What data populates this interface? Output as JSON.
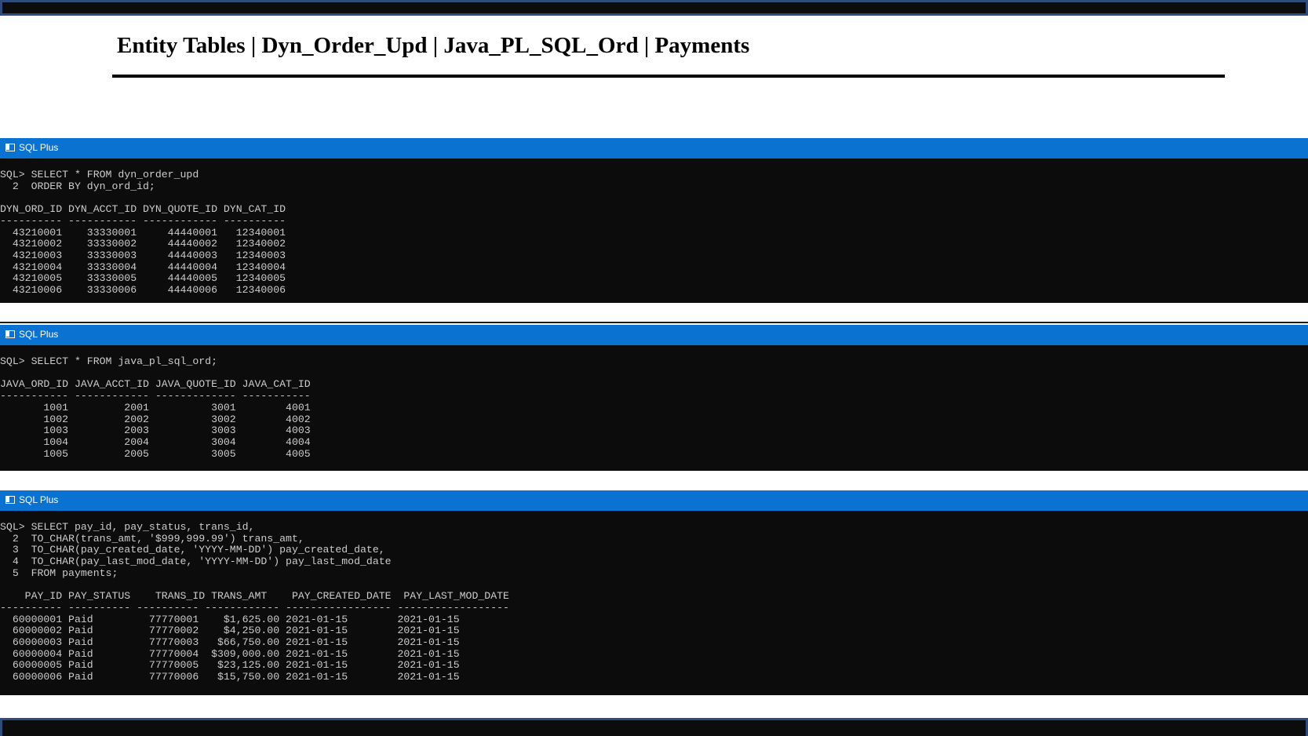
{
  "page": {
    "title": "Entity Tables | Dyn_Order_Upd | Java_PL_SQL_Ord | Payments"
  },
  "windows": [
    {
      "title": "SQL Plus",
      "query_lines": [
        "SQL> SELECT * FROM dyn_order_upd",
        "  2  ORDER BY dyn_ord_id;"
      ],
      "header": "DYN_ORD_ID DYN_ACCT_ID DYN_QUOTE_ID DYN_CAT_ID",
      "underline": "---------- ----------- ------------ ----------",
      "rows": [
        "  43210001    33330001     44440001   12340001",
        "  43210002    33330002     44440002   12340002",
        "  43210003    33330003     44440003   12340003",
        "  43210004    33330004     44440004   12340004",
        "  43210005    33330005     44440005   12340005",
        "  43210006    33330006     44440006   12340006"
      ]
    },
    {
      "title": "SQL Plus",
      "query_lines": [
        "SQL> SELECT * FROM java_pl_sql_ord;"
      ],
      "header": "JAVA_ORD_ID JAVA_ACCT_ID JAVA_QUOTE_ID JAVA_CAT_ID",
      "underline": "----------- ------------ ------------- -----------",
      "rows": [
        "       1001         2001          3001        4001",
        "       1002         2002          3002        4002",
        "       1003         2003          3003        4003",
        "       1004         2004          3004        4004",
        "       1005         2005          3005        4005"
      ]
    },
    {
      "title": "SQL Plus",
      "query_lines": [
        "SQL> SELECT pay_id, pay_status, trans_id,",
        "  2  TO_CHAR(trans_amt, '$999,999.99') trans_amt,",
        "  3  TO_CHAR(pay_created_date, 'YYYY-MM-DD') pay_created_date,",
        "  4  TO_CHAR(pay_last_mod_date, 'YYYY-MM-DD') pay_last_mod_date",
        "  5  FROM payments;"
      ],
      "header": "    PAY_ID PAY_STATUS    TRANS_ID TRANS_AMT    PAY_CREATED_DATE  PAY_LAST_MOD_DATE",
      "underline": "---------- ---------- ---------- ------------ ----------------- ------------------",
      "rows": [
        "  60000001 Paid         77770001    $1,625.00 2021-01-15        2021-01-15",
        "  60000002 Paid         77770002    $4,250.00 2021-01-15        2021-01-15",
        "  60000003 Paid         77770003   $66,750.00 2021-01-15        2021-01-15",
        "  60000004 Paid         77770004  $309,000.00 2021-01-15        2021-01-15",
        "  60000005 Paid         77770005   $23,125.00 2021-01-15        2021-01-15",
        "  60000006 Paid         77770006   $15,750.00 2021-01-15        2021-01-15"
      ]
    }
  ],
  "colors": {
    "titlebar": "#0a73d1",
    "console_bg": "#0c0c0c",
    "console_text": "#cccccc",
    "frame_border": "#2f4b7c"
  }
}
